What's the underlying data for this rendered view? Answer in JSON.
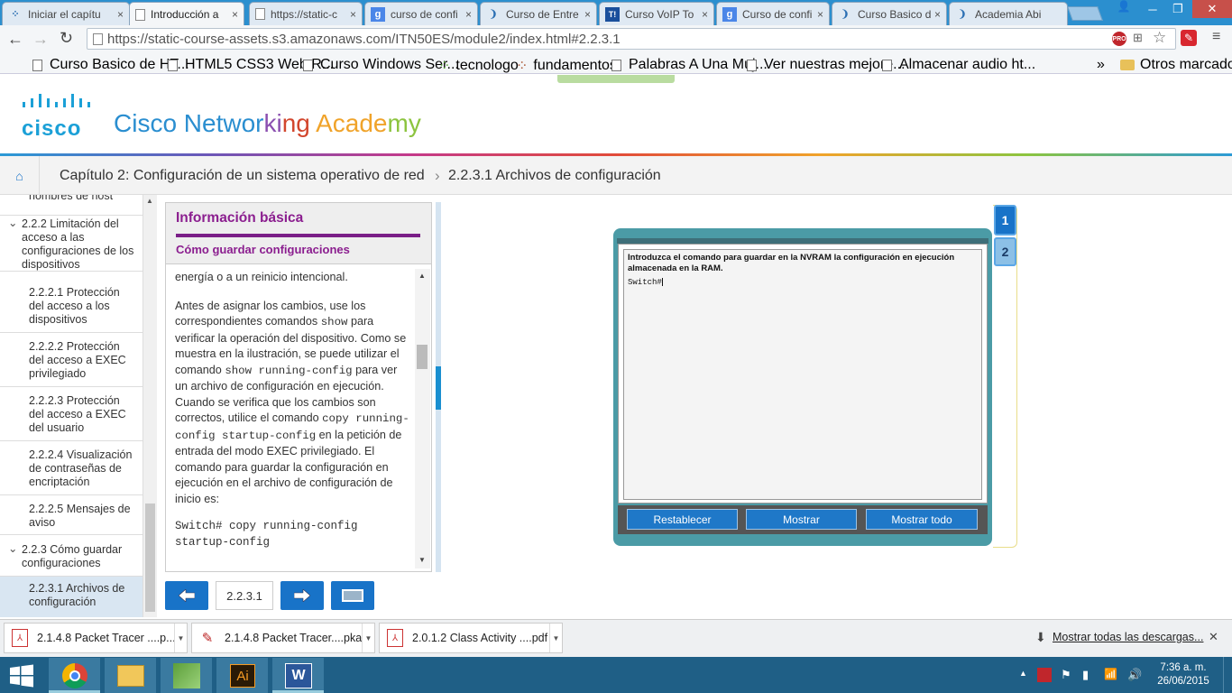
{
  "browser": {
    "tabs": [
      {
        "label": "Iniciar el capítu",
        "icon": "network-icon"
      },
      {
        "label": "Introducción a",
        "icon": "page-icon"
      },
      {
        "label": "https://static-c",
        "icon": "page-icon"
      },
      {
        "label": "curso de confi",
        "icon": "google-icon"
      },
      {
        "label": "Curso de Entre",
        "icon": "loading-icon"
      },
      {
        "label": "Curso VoIP To",
        "icon": "t-icon"
      },
      {
        "label": "Curso de confi",
        "icon": "google-icon"
      },
      {
        "label": "Curso Basico d",
        "icon": "loading-icon"
      },
      {
        "label": "Academia Abi",
        "icon": "loading-icon"
      }
    ],
    "url": "https://static-course-assets.s3.amazonaws.com/ITN50ES/module2/index.html#2.2.3.1",
    "bookmarks": [
      "Curso Basico de HT...",
      "HTML5 CSS3 Web R...",
      "Curso Windows Ser...",
      "tecnologo",
      "fundamentos",
      "Palabras A Una Muj...",
      "Ver nuestras mejore...",
      "Almacenar audio ht..."
    ],
    "bookmarks_more": "»",
    "other_bookmarks": "Otros marcadores",
    "ext_badge": "PRO"
  },
  "header": {
    "logo_text": "cisco",
    "title_parts": [
      "Cisco Networ",
      "ki",
      "ng ",
      "Acade",
      "my"
    ],
    "title_colors": [
      "#2a8ed0",
      "#8b4fb0",
      "#d2462d",
      "#f0a32a",
      "#8cc43f"
    ]
  },
  "breadcrumb": {
    "chapter": "Capítulo 2: Configuración de un sistema operativo de red",
    "separator": "›",
    "section": "2.2.3.1 Archivos de configuración"
  },
  "sidebar": {
    "items": [
      {
        "label": "nombres de host",
        "indent": 2
      },
      {
        "label": "2.2.2 Limitación del acceso a las configuraciones de los dispositivos",
        "indent": 1,
        "chevron": "⌄"
      },
      {
        "label": "2.2.2.1 Protección del acceso a los dispositivos",
        "indent": 2
      },
      {
        "label": "2.2.2.2 Protección del acceso a EXEC privilegiado",
        "indent": 2
      },
      {
        "label": "2.2.2.3 Protección del acceso a EXEC del usuario",
        "indent": 2
      },
      {
        "label": "2.2.2.4 Visualización de contraseñas de encriptación",
        "indent": 2
      },
      {
        "label": "2.2.2.5 Mensajes de aviso",
        "indent": 2
      },
      {
        "label": "2.2.3 Cómo guardar configuraciones",
        "indent": 1,
        "chevron": "⌄"
      },
      {
        "label": "2.2.3.1 Archivos de configuración",
        "indent": 2,
        "active": true
      }
    ]
  },
  "panel": {
    "title": "Información básica",
    "subtitle": "Cómo guardar configuraciones",
    "top_fragment": "energía o a un reinicio intencional.",
    "paragraph": [
      {
        "t": "Antes de asignar los cambios, use los correspondientes comandos ",
        "code": false
      },
      {
        "t": "show",
        "code": true
      },
      {
        "t": " para verificar la operación del dispositivo. Como se muestra en la ilustración, se puede utilizar el comando ",
        "code": false
      },
      {
        "t": "show running-config",
        "code": true
      },
      {
        "t": " para ver un archivo de configuración en ejecución. Cuando se verifica que los cambios son correctos, utilice el comando ",
        "code": false
      },
      {
        "t": "copy running-config startup-config",
        "code": true
      },
      {
        "t": " en la petición de entrada del modo EXEC privilegiado. El comando para guardar la configuración en ejecución en el archivo de configuración de inicio es:",
        "code": false
      }
    ],
    "code_prompt": "Switch#",
    "code_cmd": " copy running-config startup-config"
  },
  "nav": {
    "page_number": "2.2.3.1"
  },
  "activity": {
    "tabs": [
      "1",
      "2"
    ],
    "instruction": "Introduzca el comando para guardar en la NVRAM la configuración en ejecución almacenada en la RAM.",
    "prompt": "Switch#",
    "buttons": [
      "Restablecer",
      "Mostrar",
      "Mostrar todo"
    ]
  },
  "downloads": {
    "items": [
      {
        "label": "2.1.4.8 Packet Tracer ....p...",
        "icon": "pdf-icon"
      },
      {
        "label": "2.1.4.8 Packet Tracer....pka",
        "icon": "packet-tracer-icon"
      },
      {
        "label": "2.0.1.2 Class Activity ....pdf",
        "icon": "pdf-icon"
      }
    ],
    "show_all": "Mostrar todas las descargas...",
    "close": "✕"
  },
  "taskbar": {
    "time": "7:36 a. m.",
    "date": "26/06/2015",
    "apps": [
      "chrome-icon",
      "file-explorer-icon",
      "app-icon",
      "illustrator-icon",
      "word-icon"
    ],
    "ai_label": "Ai",
    "w_label": "W"
  },
  "colors": {
    "accent_blue": "#1873c8",
    "purple": "#8b1e8f",
    "teal": "#4b9ba6"
  }
}
